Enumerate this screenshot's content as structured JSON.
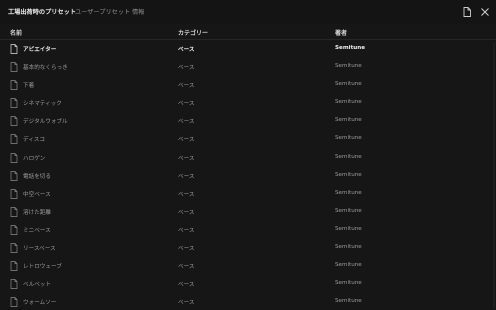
{
  "tabs": [
    {
      "label": "工場出荷時のプリセット",
      "active": true
    },
    {
      "label": "ユーザープリセット",
      "active": false
    },
    {
      "label": "情報",
      "active": false
    }
  ],
  "toolbar": {
    "doc_icon": "document-icon",
    "close_icon": "close-icon"
  },
  "table": {
    "headers": {
      "name": "名前",
      "category": "カテゴリー",
      "author": "著者"
    },
    "rows": [
      {
        "name": "アピエイター",
        "category": "ベース",
        "author": "Semitune",
        "selected": true
      },
      {
        "name": "基本的なくらっき",
        "category": "ベース",
        "author": "Semitune"
      },
      {
        "name": "下着",
        "category": "ベース",
        "author": "Semitune"
      },
      {
        "name": "シネマティック",
        "category": "ベース",
        "author": "Semitune"
      },
      {
        "name": "デジタルウォブル",
        "category": "ベース",
        "author": "Semitune"
      },
      {
        "name": "ディスコ",
        "category": "ベース",
        "author": "Semitune"
      },
      {
        "name": "ハロゲン",
        "category": "ベース",
        "author": "Semitune"
      },
      {
        "name": "電話を切る",
        "category": "ベース",
        "author": "Semitune"
      },
      {
        "name": "中空ベース",
        "category": "ベース",
        "author": "Semitune"
      },
      {
        "name": "溶けた距離",
        "category": "ベース",
        "author": "Semitune"
      },
      {
        "name": "ミニベース",
        "category": "ベース",
        "author": "Semitune"
      },
      {
        "name": "リースベース",
        "category": "ベース",
        "author": "Semitune"
      },
      {
        "name": "レトロウェーブ",
        "category": "ベース",
        "author": "Semitune"
      },
      {
        "name": "ベルベット",
        "category": "ベース",
        "author": "Semitune"
      },
      {
        "name": "ウォームソー",
        "category": "ベース",
        "author": "Semitune"
      }
    ]
  },
  "colors": {
    "background": "#161616",
    "text": "#9b9b9b",
    "active_text": "#f0f0f0"
  }
}
